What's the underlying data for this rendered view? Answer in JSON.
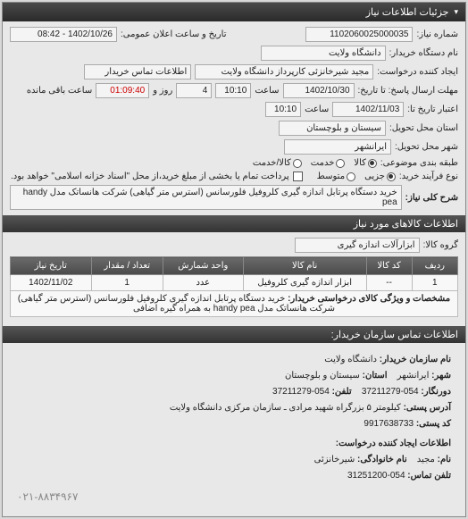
{
  "panel_title": "جزئیات اطلاعات نیاز",
  "header": {
    "req_no_label": "شماره نیاز:",
    "req_no": "1102060025000035",
    "announce_label": "تاریخ و ساعت اعلان عمومی:",
    "announce_value": "1402/10/26 - 08:42"
  },
  "buyer": {
    "org_label": "نام دستگاه خریدار:",
    "org_value": "دانشگاه ولایت",
    "creator_label": "ایجاد کننده درخواست:",
    "creator_value": "مجید شیرخانزئی کارپرداز دانشگاه ولایت",
    "contact_icon_label": "اطلاعات تماس خریدار"
  },
  "deadlines": {
    "response_to_label": "مهلت ارسال پاسخ: تا تاریخ:",
    "response_date": "1402/10/30",
    "time_label": "ساعت",
    "response_time": "10:10",
    "days_label": "روز و",
    "days_value": "4",
    "remain_label": "ساعت باقی مانده",
    "remain_value": "01:09:40",
    "validity_to_label": "اعتبار تاریخ تا:",
    "validity_date": "1402/11/03",
    "validity_time": "10:10"
  },
  "location": {
    "province_label": "استان محل تحویل:",
    "province_value": "سیستان و بلوچستان",
    "city_label": "شهر محل تحویل:",
    "city_value": "ایرانشهر"
  },
  "classification": {
    "category_label": "طبقه بندی موضوعی:",
    "options": {
      "goods": "کالا",
      "service": "خدمت",
      "lc": "کالا/خدمت"
    },
    "selected": "goods",
    "buy_type_label": "نوع فرآیند خرید:",
    "buy_options": {
      "low": "متوسط",
      "mid": "جزیی"
    },
    "buy_selected": "mid",
    "payment_label": "پرداخت تمام یا بخشی از مبلغ خرید،از محل \"اسناد خزانه اسلامی\" خواهد بود.",
    "payment_checked": false
  },
  "need": {
    "title_label": "شرح کلی نیاز:",
    "title_value": "خرید دستگاه پرتابل اندازه گیری کلروفیل فلورسانس (استرس متر گیاهی) شرکت هانساتک مدل handy pea"
  },
  "items_section_title": "اطلاعات کالاهای مورد نیاز",
  "group": {
    "label": "گروه کالا:",
    "value": "ابزارآلات اندازه گیری"
  },
  "table": {
    "headers": {
      "row": "ردیف",
      "code": "کد کالا",
      "name": "نام کالا",
      "unit": "واحد شمارش",
      "qty": "تعداد / مقدار",
      "date": "تاریخ نیاز"
    },
    "rows": [
      {
        "row": "1",
        "code": "--",
        "name": "ابزار اندازه گیری کلروفیل",
        "unit": "عدد",
        "qty": "1",
        "date": "1402/11/02"
      }
    ],
    "detail": {
      "label": "مشخصات و ویژگی کالای درخواستی خریدار:",
      "value": "خرید دستگاه پرتابل اندازه گیری کلروفیل فلورسانس (استرس متر گیاهی) شرکت هانساتک مدل handy pea به همراه گیره اضافی"
    }
  },
  "contact_section_title": "اطلاعات تماس سازمان خریدار:",
  "contact": {
    "org_label": "نام سازمان خریدار:",
    "org_value": "دانشگاه ولایت",
    "city_label": "شهر:",
    "city_value": "ایرانشهر",
    "province_label": "استان:",
    "province_value": "سیستان و بلوچستان",
    "fax_label": "دورنگار:",
    "fax_value": "054-37211279",
    "phone_label": "تلفن:",
    "phone_value": "054-37211279",
    "address_label": "آدرس پستی:",
    "address_value": "کیلومتر ۵ بزرگراه شهید مرادی ـ سازمان مرکزی دانشگاه ولایت",
    "postal_label": "کد پستی:",
    "postal_value": "9917638733",
    "creator_section": "اطلاعات ایجاد کننده درخواست:",
    "name_label": "نام:",
    "name_value": "مجید",
    "surname_label": "نام خانوادگی:",
    "surname_value": "شیرخانزئی",
    "tel_label": "تلفن تماس:",
    "tel_value": "054-31251200",
    "footer_phone": "۰۲۱-۸۸۳۴۹۶۷"
  }
}
